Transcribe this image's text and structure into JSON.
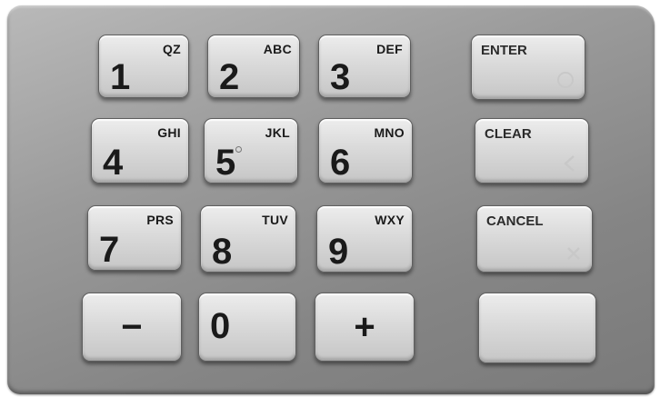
{
  "keypad": {
    "row1": {
      "k1": {
        "number": "1",
        "letters": "QZ"
      },
      "k2": {
        "number": "2",
        "letters": "ABC"
      },
      "k3": {
        "number": "3",
        "letters": "DEF"
      },
      "enter": {
        "label": "ENTER",
        "icon": "circle-icon"
      }
    },
    "row2": {
      "k4": {
        "number": "4",
        "letters": "GHI"
      },
      "k5": {
        "number": "5",
        "letters": "JKL"
      },
      "k6": {
        "number": "6",
        "letters": "MNO"
      },
      "clear": {
        "label": "CLEAR",
        "icon": "chevron-left-icon"
      }
    },
    "row3": {
      "k7": {
        "number": "7",
        "letters": "PRS"
      },
      "k8": {
        "number": "8",
        "letters": "TUV"
      },
      "k9": {
        "number": "9",
        "letters": "WXY"
      },
      "cancel": {
        "label": "CANCEL",
        "icon": "x-icon"
      }
    },
    "row4": {
      "minus": {
        "symbol": "−"
      },
      "k0": {
        "number": "0"
      },
      "plus": {
        "symbol": "+"
      },
      "blank": {
        "label": ""
      }
    }
  },
  "colors": {
    "plate": "#9b9b9b",
    "key": "#dcdcdc",
    "text": "#1a1a1a"
  }
}
